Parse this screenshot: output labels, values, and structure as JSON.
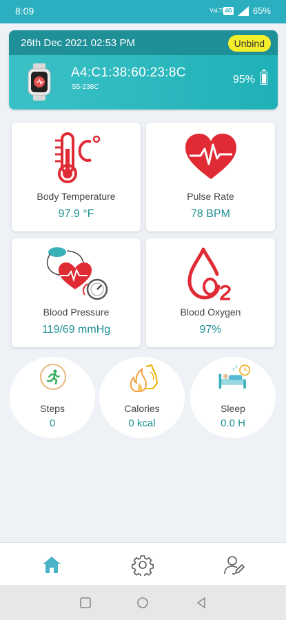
{
  "status_bar": {
    "time": "8:09",
    "data_label": "VoLTE",
    "sim_label": "4G",
    "battery": "65%"
  },
  "device": {
    "date": "26th Dec 2021 02:53 PM",
    "unbind_label": "Unbind",
    "mac": "A4:C1:38:60:23:8C",
    "model": "S5-238C",
    "battery": "95%"
  },
  "metrics": [
    {
      "label": "Body Temperature",
      "value": "97.9 °F",
      "icon": "thermometer-icon"
    },
    {
      "label": "Pulse Rate",
      "value": "78 BPM",
      "icon": "heart-pulse-icon"
    },
    {
      "label": "Blood Pressure",
      "value": "119/69 mmHg",
      "icon": "blood-pressure-icon"
    },
    {
      "label": "Blood Oxygen",
      "value": "97%",
      "icon": "oxygen-drop-icon"
    }
  ],
  "stats": [
    {
      "label": "Steps",
      "value": "0",
      "icon": "running-icon"
    },
    {
      "label": "Calories",
      "value": "0 kcal",
      "icon": "flame-muscle-icon"
    },
    {
      "label": "Sleep",
      "value": "0.0 H",
      "icon": "bed-clock-icon"
    }
  ],
  "nav": {
    "active": "home",
    "items": [
      "home-icon",
      "gear-icon",
      "profile-edit-icon"
    ]
  },
  "colors": {
    "accent": "#2bafc0",
    "header_dark": "#1f8f98",
    "value_teal": "#1e8f94",
    "icon_red": "#e02b35",
    "unbind_yellow": "#f5ee2a"
  }
}
